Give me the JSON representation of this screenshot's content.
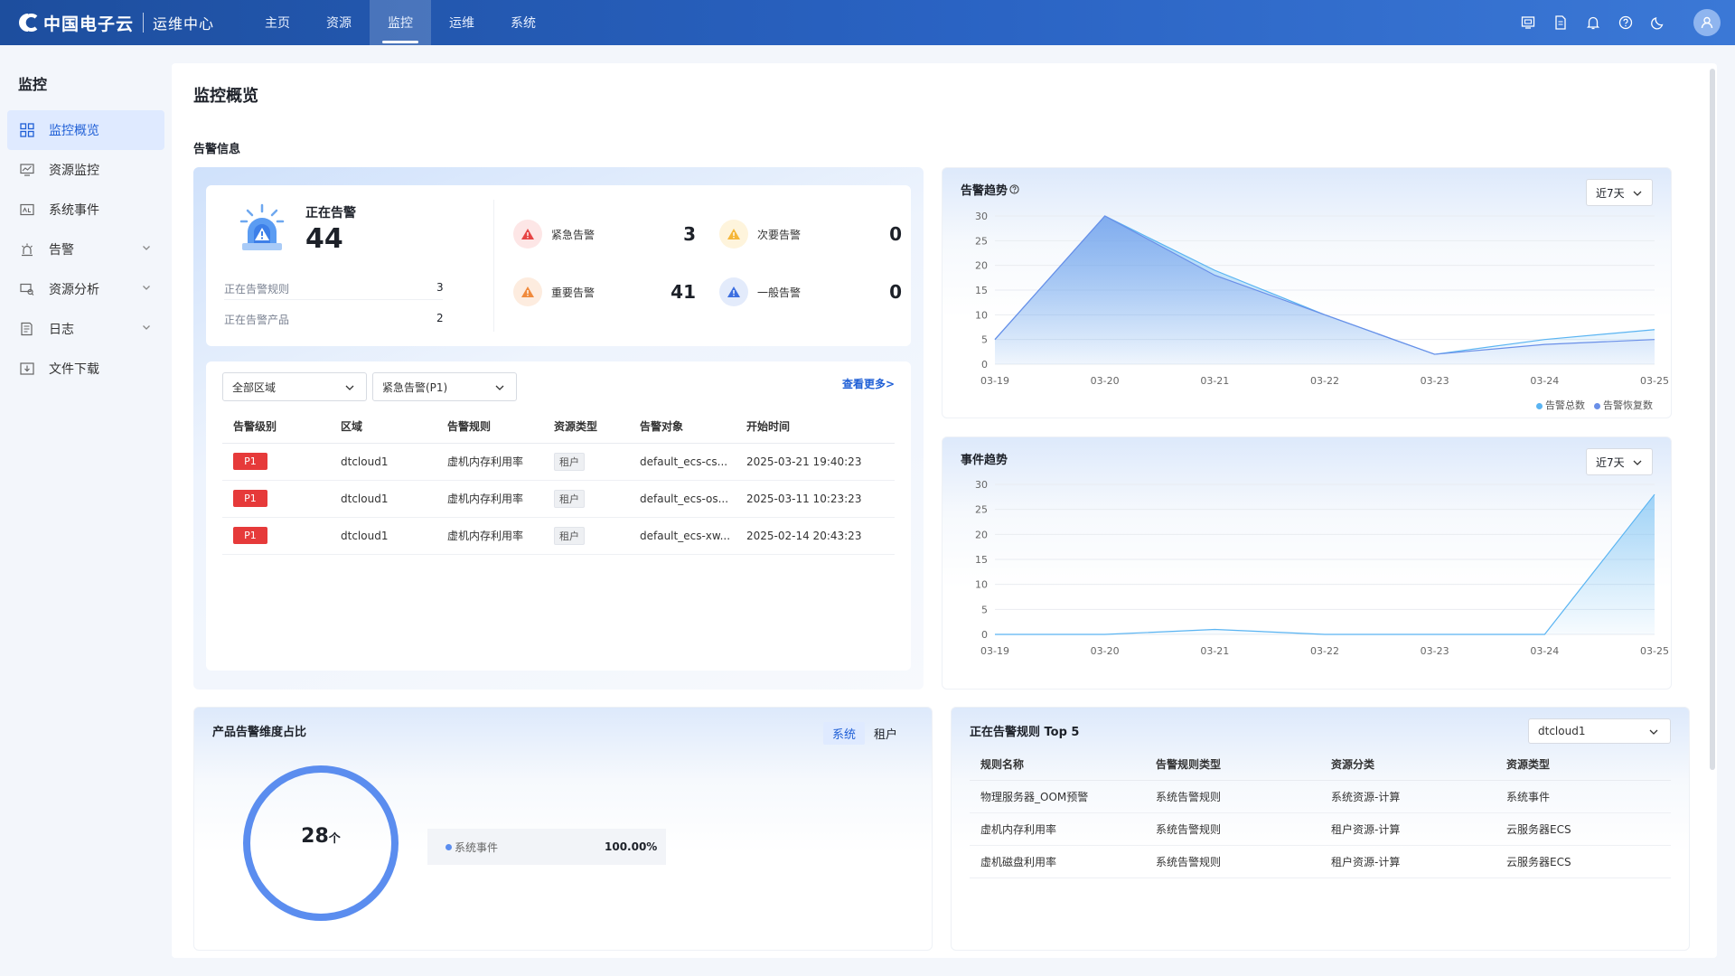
{
  "brand": {
    "name": "中国电子云",
    "sub": "运维中心"
  },
  "nav": [
    {
      "label": "主页",
      "active": false
    },
    {
      "label": "资源",
      "active": false
    },
    {
      "label": "监控",
      "active": true
    },
    {
      "label": "运维",
      "active": false
    },
    {
      "label": "系统",
      "active": false
    }
  ],
  "sidebar": {
    "title": "监控",
    "items": [
      {
        "label": "监控概览",
        "icon": "grid-icon",
        "active": true,
        "expand": false
      },
      {
        "label": "资源监控",
        "icon": "monitor-icon",
        "active": false,
        "expand": false
      },
      {
        "label": "系统事件",
        "icon": "event-icon",
        "active": false,
        "expand": false
      },
      {
        "label": "告警",
        "icon": "alarm-icon",
        "active": false,
        "expand": true
      },
      {
        "label": "资源分析",
        "icon": "analysis-icon",
        "active": false,
        "expand": true
      },
      {
        "label": "日志",
        "icon": "log-icon",
        "active": false,
        "expand": true
      },
      {
        "label": "文件下载",
        "icon": "download-icon",
        "active": false,
        "expand": false
      }
    ]
  },
  "page": {
    "title": "监控概览",
    "section": "告警信息"
  },
  "alarm_summary": {
    "label": "正在告警",
    "total": "44",
    "rules_label": "正在告警规则",
    "rules_value": "3",
    "products_label": "正在告警产品",
    "products_value": "2",
    "severities": [
      {
        "label": "紧急告警",
        "value": "3",
        "color": "#e64545"
      },
      {
        "label": "次要告警",
        "value": "0",
        "color": "#f5b638"
      },
      {
        "label": "重要告警",
        "value": "41",
        "color": "#f08a3c"
      },
      {
        "label": "一般告警",
        "value": "0",
        "color": "#3d6fe0"
      }
    ]
  },
  "alarm_table": {
    "region_select": "全部区域",
    "level_select": "紧急告警(P1)",
    "more": "查看更多>",
    "headers": [
      "告警级别",
      "区域",
      "告警规则",
      "资源类型",
      "告警对象",
      "开始时间"
    ],
    "rows": [
      {
        "level": "P1",
        "region": "dtcloud1",
        "rule": "虚机内存利用率",
        "type": "租户",
        "object": "default_ecs-cs...",
        "time": "2025-03-21 19:40:23"
      },
      {
        "level": "P1",
        "region": "dtcloud1",
        "rule": "虚机内存利用率",
        "type": "租户",
        "object": "default_ecs-os...",
        "time": "2025-03-11 10:23:23"
      },
      {
        "level": "P1",
        "region": "dtcloud1",
        "rule": "虚机内存利用率",
        "type": "租户",
        "object": "default_ecs-xw...",
        "time": "2025-02-14 20:43:23"
      }
    ]
  },
  "alarm_trend": {
    "title": "告警趋势",
    "range": "近7天",
    "legend": [
      "告警总数",
      "告警恢复数"
    ]
  },
  "event_trend": {
    "title": "事件趋势",
    "range": "近7天"
  },
  "chart_data": [
    {
      "type": "area",
      "title": "告警趋势",
      "x": [
        "03-19",
        "03-20",
        "03-21",
        "03-22",
        "03-23",
        "03-24",
        "03-25"
      ],
      "yticks": [
        0,
        5,
        10,
        15,
        20,
        25,
        30
      ],
      "ylim": [
        0,
        30
      ],
      "series": [
        {
          "name": "告警总数",
          "values": [
            5,
            30,
            19,
            10,
            2,
            5,
            7
          ],
          "color": "#5ab4f2"
        },
        {
          "name": "告警恢复数",
          "values": [
            5,
            30,
            18,
            10,
            2,
            4,
            5
          ],
          "color": "#6a8fe8"
        }
      ],
      "legend": "bottom-right",
      "grid": true
    },
    {
      "type": "area",
      "title": "事件趋势",
      "x": [
        "03-19",
        "03-20",
        "03-21",
        "03-22",
        "03-23",
        "03-24",
        "03-25"
      ],
      "yticks": [
        0,
        5,
        10,
        15,
        20,
        25,
        30
      ],
      "ylim": [
        0,
        30
      ],
      "series": [
        {
          "values": [
            0,
            0,
            1,
            0,
            0,
            0,
            28
          ],
          "color": "#5ab4f2"
        }
      ],
      "grid": true
    },
    {
      "type": "pie",
      "title": "产品告警维度占比",
      "center_value": "28",
      "center_unit": "个",
      "slices": [
        {
          "label": "系统事件",
          "value": 100.0,
          "display": "100.00%",
          "color": "#5b8def"
        }
      ]
    }
  ],
  "product_ratio": {
    "title": "产品告警维度占比",
    "tabs": [
      "系统",
      "租户"
    ],
    "total": "28",
    "unit": "个",
    "legend_label": "系统事件",
    "legend_value": "100.00%"
  },
  "top5": {
    "title": "正在告警规则 Top 5",
    "region": "dtcloud1",
    "headers": [
      "规则名称",
      "告警规则类型",
      "资源分类",
      "资源类型"
    ],
    "rows": [
      {
        "name": "物理服务器_OOM预警",
        "rule_type": "系统告警规则",
        "category": "系统资源-计算",
        "res_type": "系统事件"
      },
      {
        "name": "虚机内存利用率",
        "rule_type": "系统告警规则",
        "category": "租户资源-计算",
        "res_type": "云服务器ECS"
      },
      {
        "name": "虚机磁盘利用率",
        "rule_type": "系统告警规则",
        "category": "租户资源-计算",
        "res_type": "云服务器ECS"
      }
    ]
  }
}
